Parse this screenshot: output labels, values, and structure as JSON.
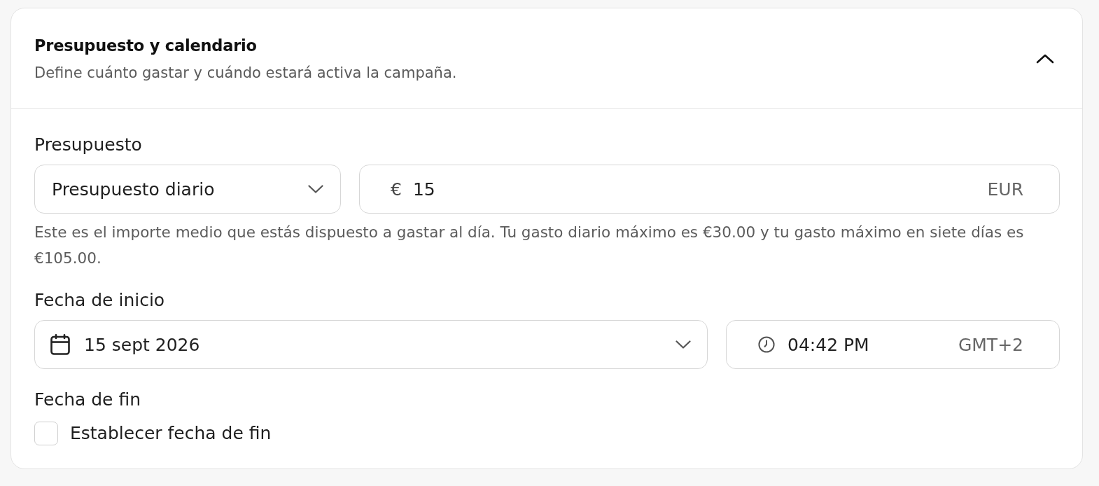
{
  "section": {
    "title": "Presupuesto y calendario",
    "subtitle": "Define cuánto gastar y cuándo estará activa la campaña.",
    "expanded": true
  },
  "budget": {
    "label": "Presupuesto",
    "type_select": {
      "value": "Presupuesto diario"
    },
    "amount": {
      "currency_symbol": "€",
      "value": "15",
      "currency": "EUR"
    },
    "helper": "Este es el importe medio que estás dispuesto a gastar al día. Tu gasto diario máximo es €30.00 y tu gasto máximo en siete días es €105.00."
  },
  "start_date": {
    "label": "Fecha de inicio",
    "date": {
      "value": "15 sept 2026"
    },
    "time": {
      "value": "04:42 PM",
      "timezone": "GMT+2"
    }
  },
  "end_date": {
    "label": "Fecha de fin",
    "checkbox": {
      "label": "Establecer fecha de fin",
      "checked": false
    }
  }
}
